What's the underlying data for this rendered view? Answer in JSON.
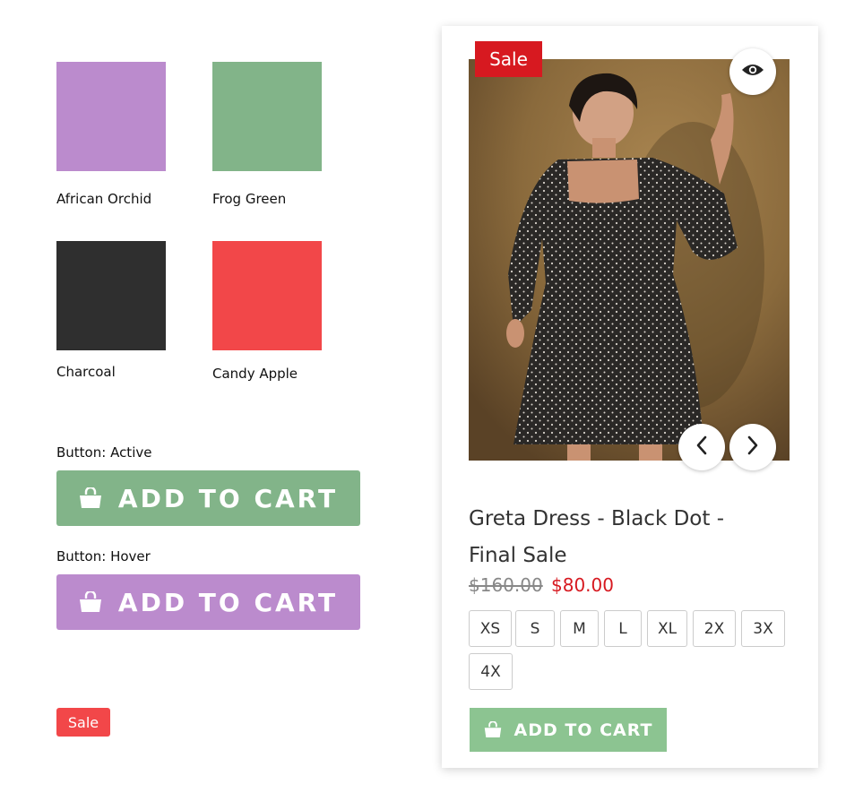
{
  "swatches": [
    {
      "name": "African Orchid",
      "color": "#bb8bcd"
    },
    {
      "name": "Frog Green",
      "color": "#82b489"
    },
    {
      "name": "Charcoal",
      "color": "#2f2f2f"
    },
    {
      "name": "Candy Apple",
      "color": "#f24749"
    }
  ],
  "buttons": {
    "active_label": "Button: Active",
    "active_text": "ADD TO CART",
    "active_color": "#82b489",
    "hover_label": "Button: Hover",
    "hover_text": "ADD TO CART",
    "hover_color": "#bb8bcd"
  },
  "sale_badge": "Sale",
  "product": {
    "sale_tag": "Sale",
    "title": "Greta Dress - Black Dot - Final Sale",
    "price_original": "$160.00",
    "price_sale": "$80.00",
    "sizes": [
      "XS",
      "S",
      "M",
      "L",
      "XL",
      "2X",
      "3X",
      "4X"
    ],
    "add_to_cart": "ADD TO CART",
    "icons": {
      "quick_view": "eye-icon",
      "prev": "chevron-left-icon",
      "next": "chevron-right-icon",
      "cart": "shopping-bag-icon"
    }
  }
}
